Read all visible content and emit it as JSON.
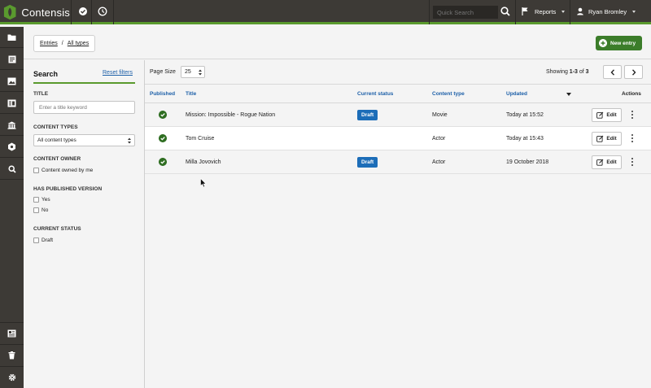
{
  "app": {
    "name": "Contensis"
  },
  "topbar": {
    "search_placeholder": "Quick Search",
    "reports_label": "Reports",
    "user_name": "Ryan Bromley"
  },
  "breadcrumb": {
    "root": "Entries",
    "separator": "/",
    "current": "All types"
  },
  "actions": {
    "new_entry_label": "New entry"
  },
  "filters": {
    "title": "Search",
    "reset_label": "Reset filters",
    "title_label": "TITLE",
    "title_placeholder": "Enter a title keyword",
    "content_types_label": "CONTENT TYPES",
    "content_types_value": "All content types",
    "content_owner_label": "CONTENT OWNER",
    "content_owner_option": "Content owned by me",
    "has_published_label": "HAS PUBLISHED VERSION",
    "has_published_options": [
      "Yes",
      "No"
    ],
    "current_status_label": "CURRENT STATUS",
    "current_status_options": [
      "Draft"
    ]
  },
  "list": {
    "page_size_label": "Page Size",
    "page_size_value": "25",
    "showing_prefix": "Showing ",
    "showing_range": "1-3",
    "showing_of": " of ",
    "showing_total": "3",
    "columns": {
      "published": "Published",
      "title": "Title",
      "status": "Current status",
      "content_type": "Content type",
      "updated": "Updated",
      "actions": "Actions"
    },
    "edit_label": "Edit",
    "rows": [
      {
        "title": "Mission: Impossible - Rogue Nation",
        "status": "Draft",
        "content_type": "Movie",
        "updated": "Today at 15:52"
      },
      {
        "title": "Tom Cruise",
        "status": "",
        "content_type": "Actor",
        "updated": "Today at 15:43"
      },
      {
        "title": "Milla Jovovich",
        "status": "Draft",
        "content_type": "Actor",
        "updated": "19 October 2018"
      }
    ]
  },
  "colors": {
    "topbar": "#3d3a36",
    "accent_green": "#5a9a2e",
    "button_green": "#3c7d2a",
    "link_blue": "#1c5fa8",
    "badge_blue": "#1c6db8"
  }
}
